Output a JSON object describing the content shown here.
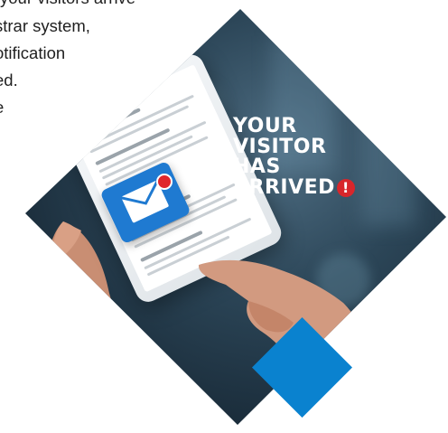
{
  "intro": {
    "lines": [
      "your visitors arrive",
      "strar system,",
      "otification",
      "ed.",
      "e"
    ]
  },
  "headline": {
    "line1": "YOUR",
    "line2": "VISITOR",
    "line3": "HAS",
    "line4": "ARRIVED",
    "exclaim": "!"
  },
  "colors": {
    "accent_blue": "#0a82cf",
    "mail_blue": "#1f7ad1",
    "alert_red": "#d8262b",
    "frame_dark": "#1a2c3a"
  },
  "icons": [
    "envelope-icon",
    "notification-dot-icon",
    "exclamation-icon"
  ]
}
